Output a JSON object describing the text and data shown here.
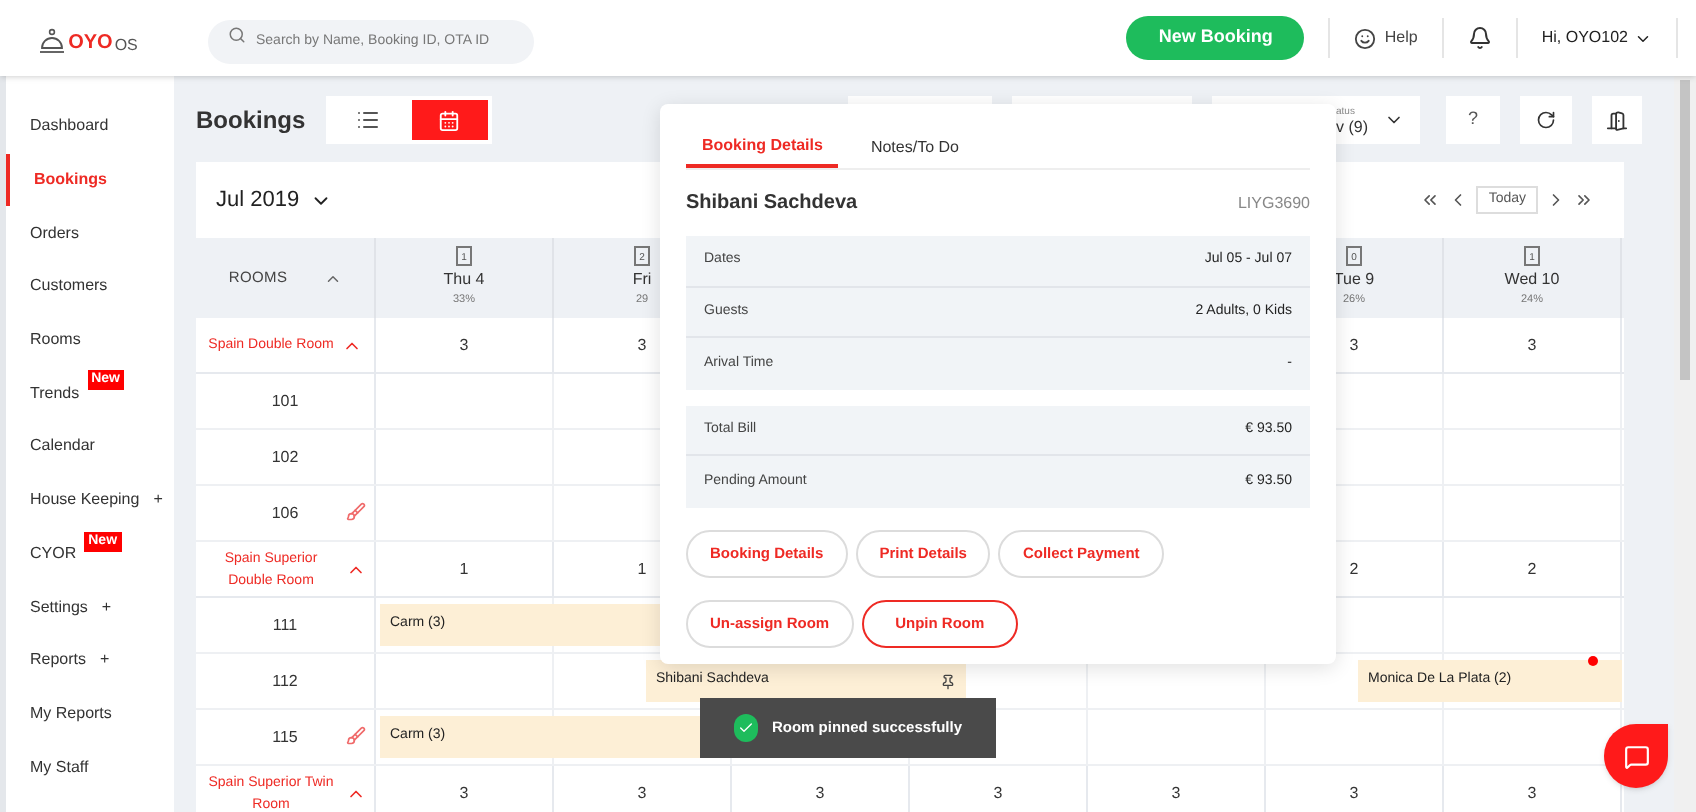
{
  "header": {
    "logo_brand": "OYO",
    "logo_suffix": "OS",
    "search": {
      "placeholder": "Search by Name, Booking ID, OTA ID"
    },
    "new_booking": "New Booking",
    "help": "Help",
    "user": "Hi, OYO102"
  },
  "sidebar": {
    "items": [
      {
        "label": "Dashboard",
        "selected": false
      },
      {
        "label": "Bookings",
        "selected": true
      },
      {
        "label": "Orders",
        "selected": false
      },
      {
        "label": "Customers",
        "selected": false
      },
      {
        "label": "Rooms",
        "selected": false
      },
      {
        "label": "Trends",
        "selected": false,
        "badge": "New"
      },
      {
        "label": "Calendar",
        "selected": false
      },
      {
        "label": "House Keeping",
        "selected": false,
        "expander": "+"
      },
      {
        "label": "CYOR",
        "selected": false,
        "badge": "New"
      },
      {
        "label": "Settings",
        "selected": false,
        "expander": "+"
      },
      {
        "label": "Reports",
        "selected": false,
        "expander": "+"
      },
      {
        "label": "My Reports",
        "selected": false
      },
      {
        "label": "My Staff",
        "selected": false
      }
    ]
  },
  "page": {
    "title": "Bookings",
    "views": [
      {
        "kind": "list",
        "selected": false
      },
      {
        "kind": "calendar",
        "selected": true
      }
    ],
    "status_filter": {
      "label": "atus",
      "value": "v (9)"
    },
    "help_button": "?"
  },
  "calendar": {
    "month": "Jul 2019",
    "rooms_heading": "ROOMS",
    "today": "Today",
    "days": [
      {
        "count": "1",
        "day": "Thu 4",
        "occupancy": "33%"
      },
      {
        "count": "2",
        "day": "Fri",
        "occupancy": "29"
      },
      {
        "count": "0",
        "day": "Tue 9",
        "occupancy": "26%"
      },
      {
        "count": "1",
        "day": "Wed 10",
        "occupancy": "24%"
      }
    ],
    "rows": [
      {
        "kind": "group",
        "name": "Spain Double Room",
        "expanded": true,
        "cells": [
          "3",
          "3",
          null,
          null,
          null,
          "3",
          "3"
        ]
      },
      {
        "kind": "room",
        "name": "101",
        "dirty": false,
        "bookings": []
      },
      {
        "kind": "room",
        "name": "102",
        "dirty": false,
        "bookings": []
      },
      {
        "kind": "room",
        "name": "106",
        "dirty": true,
        "bookings": []
      },
      {
        "kind": "group",
        "name": "Spain Superior Double Room",
        "expanded": true,
        "cells": [
          "1",
          "1",
          null,
          null,
          null,
          "2",
          "2"
        ]
      },
      {
        "kind": "room",
        "name": "111",
        "dirty": false,
        "bookings": [
          {
            "guest": "Carm (3)",
            "pinned": false,
            "flagged": false
          }
        ]
      },
      {
        "kind": "room",
        "name": "112",
        "dirty": false,
        "bookings": [
          {
            "guest": "Shibani Sachdeva",
            "pinned": true,
            "flagged": false
          },
          {
            "guest": "Monica De La Plata (2)",
            "pinned": false,
            "flagged": true
          }
        ]
      },
      {
        "kind": "room",
        "name": "115",
        "dirty": true,
        "bookings": [
          {
            "guest": "Carm (3)",
            "pinned": false,
            "flagged": false
          }
        ]
      },
      {
        "kind": "group",
        "name": "Spain Superior Twin Room",
        "expanded": true,
        "cells": [
          "3",
          "3",
          "3",
          "3",
          "3",
          "3",
          "3"
        ]
      }
    ]
  },
  "popup": {
    "tabs": [
      {
        "label": "Booking Details",
        "selected": true
      },
      {
        "label": "Notes/To Do",
        "selected": false
      }
    ],
    "guest": "Shibani Sachdeva",
    "booking_id": "LIYG3690",
    "details": [
      {
        "label": "Dates",
        "value": "Jul 05 - Jul 07"
      },
      {
        "label": "Guests",
        "value": "2 Adults, 0 Kids"
      },
      {
        "label": "Arival Time",
        "value": "-"
      }
    ],
    "amounts": [
      {
        "label": "Total Bill",
        "value": "€ 93.50"
      },
      {
        "label": "Pending Amount",
        "value": "€ 93.50"
      }
    ],
    "actions": [
      [
        {
          "label": "Booking Details",
          "emphasized": false
        },
        {
          "label": "Print Details",
          "emphasized": false
        },
        {
          "label": "Collect Payment",
          "emphasized": false
        }
      ],
      [
        {
          "label": "Un-assign Room",
          "emphasized": false
        },
        {
          "label": "Unpin Room",
          "emphasized": true
        }
      ]
    ]
  },
  "toast": {
    "message": "Room pinned successfully"
  }
}
